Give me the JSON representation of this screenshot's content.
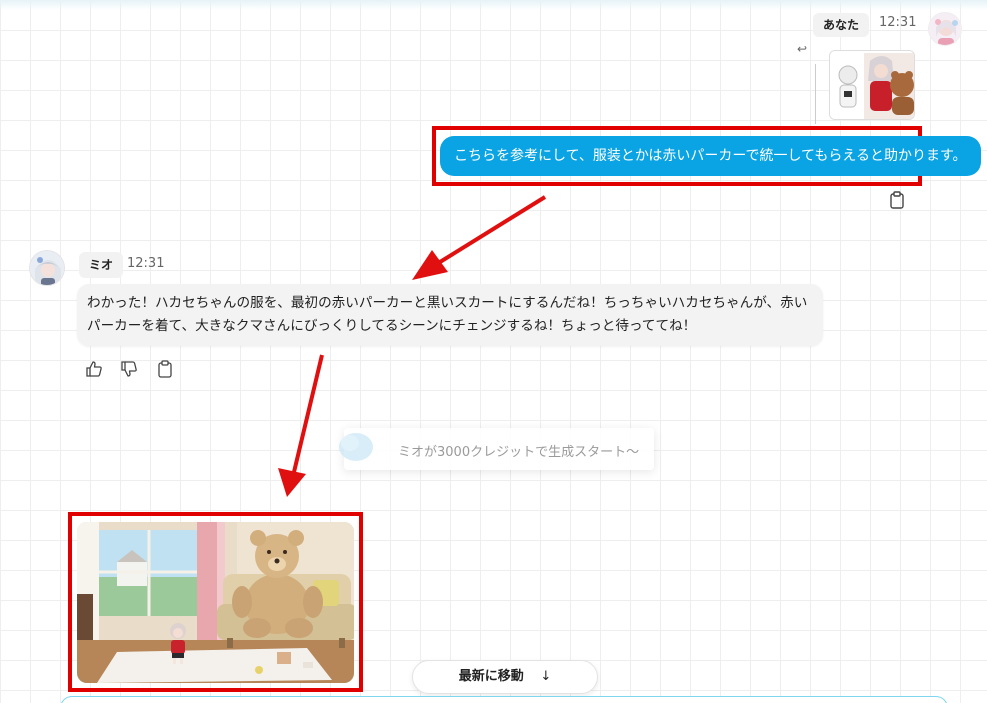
{
  "user": {
    "name": "あなた",
    "time": "12:31",
    "message": "こちらを参考にして、服装とかは赤いパーカーで統一してもらえると助かります。"
  },
  "assistant": {
    "name": "ミオ",
    "time": "12:31",
    "message": "わかった！ハカセちゃんの服を、最初の赤いパーカーと黒いスカートにするんだね！ちっちゃいハカセちゃんが、赤いパーカーを着て、大きなクマさんにびっくりしてるシーンにチェンジするね！ちょっと待っててね！"
  },
  "status": {
    "text": "ミオが3000クレジットで生成スタート〜"
  },
  "jump_button": {
    "label": "最新に移動"
  },
  "icons": {
    "reply": "reply-icon",
    "copy": "clipboard-icon",
    "like": "thumbs-up-icon",
    "dislike": "thumbs-down-icon",
    "arrow_down": "arrow-down-icon"
  },
  "colors": {
    "user_bubble": "#0aa3e3",
    "annotation": "#e00000",
    "bot_bubble": "#f3f3f3"
  }
}
